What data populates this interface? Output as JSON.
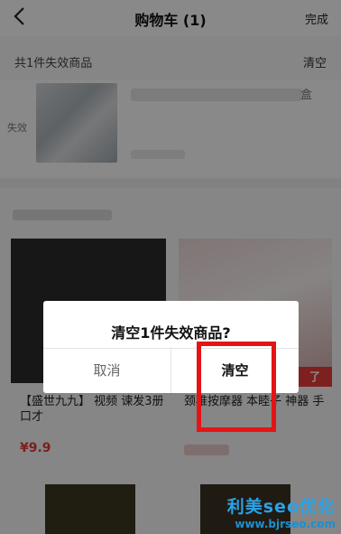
{
  "navbar": {
    "title": "购物车 (1)",
    "done_label": "完成"
  },
  "invalid_section": {
    "count_label": "共1件失效商品",
    "clear_label": "清空",
    "tag_label": "失效",
    "edge_text": "盒"
  },
  "recommendations": {
    "items": [
      {
        "name": "【盛世九九】 视频 谏发3册 口才",
        "price": "¥9.9"
      },
      {
        "name": "颈椎按摩器 本睦子 神器 手"
      }
    ],
    "badge_text": "了"
  },
  "dialog": {
    "title": "清空1件失效商品?",
    "cancel_label": "取消",
    "confirm_label": "清空"
  },
  "watermark": {
    "brand": "利美seo优化",
    "url": "www.bjrseo.com"
  },
  "colors": {
    "highlight": "#e51414",
    "price": "#e23a3a",
    "watermark": "#2aa3e8"
  }
}
